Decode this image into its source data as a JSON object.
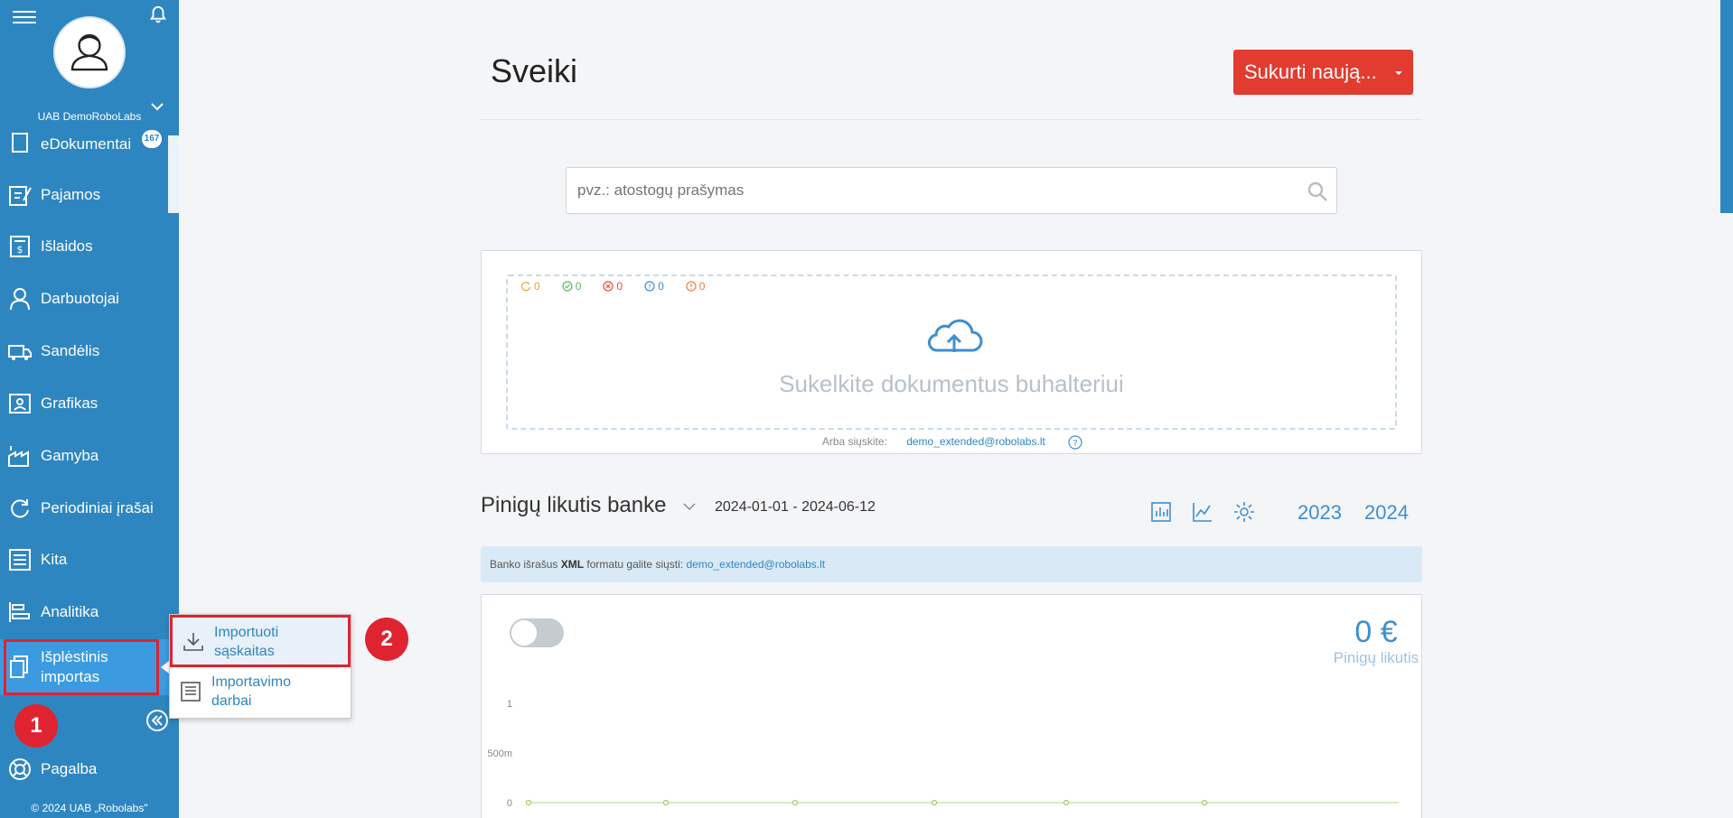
{
  "sidebar": {
    "company": "UAB DemoRoboLabs",
    "items": [
      {
        "label": "eDokumentai",
        "badge": "167"
      },
      {
        "label": "Pajamos"
      },
      {
        "label": "Išlaidos"
      },
      {
        "label": "Darbuotojai"
      },
      {
        "label": "Sandėlis"
      },
      {
        "label": "Grafikas"
      },
      {
        "label": "Gamyba"
      },
      {
        "label": "Periodiniai įrašai"
      },
      {
        "label": "Kita"
      },
      {
        "label": "Analitika"
      },
      {
        "label_line1": "Išplėstinis",
        "label_line2": "importas"
      },
      {
        "label": "Pagalba"
      }
    ],
    "footer": "© 2024 UAB „Robolabs\""
  },
  "popup": {
    "items": [
      {
        "line1": "Importuoti",
        "line2": "sąskaitas"
      },
      {
        "line1": "Importavimo",
        "line2": "darbai"
      }
    ]
  },
  "annotations": {
    "step1": "1",
    "step2": "2"
  },
  "header": {
    "title": "Sveiki",
    "create_button": "Sukurti naują..."
  },
  "search": {
    "placeholder": "pvz.: atostogų prašymas"
  },
  "upload": {
    "stats": [
      {
        "icon": "sync-icon",
        "value": "0",
        "color": "#f0a030"
      },
      {
        "icon": "check-circle-icon",
        "value": "0",
        "color": "#5cb85c"
      },
      {
        "icon": "x-circle-icon",
        "value": "0",
        "color": "#e74c3c"
      },
      {
        "icon": "question-circle-icon",
        "value": "0",
        "color": "#3d8fcf"
      },
      {
        "icon": "info-circle-icon",
        "value": "0",
        "color": "#f0803c"
      }
    ],
    "text": "Sukelkite dokumentus buhalteriui",
    "send_prefix": "Arba siųskite:",
    "email": "demo_extended@robolabs.lt"
  },
  "bank": {
    "title": "Pinigų likutis banke",
    "dates": "2024-01-01 - 2024-06-12",
    "years": [
      "2023",
      "2024"
    ],
    "info_prefix": "Banko išrašus",
    "info_bold": "XML",
    "info_middle": "formatu galite siųsti:",
    "info_email": "demo_extended@robolabs.lt",
    "amount": "0 €",
    "amount_label": "Pinigų likutis"
  },
  "chart_data": {
    "type": "line",
    "y_ticks": [
      "1",
      "500m",
      "0"
    ],
    "ylim": [
      0,
      1
    ],
    "series": [
      {
        "values": [
          0,
          0,
          0,
          0,
          0,
          0
        ]
      }
    ]
  },
  "colors": {
    "accent": "#2e86c1",
    "primary_button": "#e23b30",
    "annotation": "#e02330"
  }
}
